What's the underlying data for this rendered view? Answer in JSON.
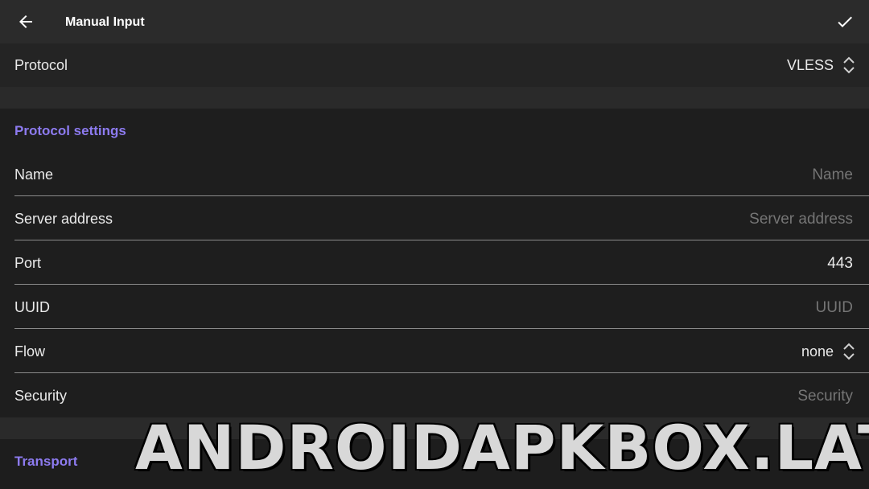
{
  "toolbar": {
    "title": "Manual Input",
    "back_icon": "arrow-left-icon",
    "confirm_icon": "check-icon"
  },
  "protocol": {
    "label": "Protocol",
    "value": "VLESS"
  },
  "protocol_settings": {
    "header": "Protocol settings",
    "fields": [
      {
        "label": "Name",
        "placeholder": "Name",
        "value": ""
      },
      {
        "label": "Server address",
        "placeholder": "Server address",
        "value": ""
      },
      {
        "label": "Port",
        "placeholder": "",
        "value": "443"
      },
      {
        "label": "UUID",
        "placeholder": "UUID",
        "value": ""
      },
      {
        "label": "Flow",
        "value": "none"
      },
      {
        "label": "Security",
        "placeholder": "Security",
        "value": ""
      }
    ]
  },
  "transport": {
    "header": "Transport"
  },
  "watermark": "ANDROIDAPKBOX.LAT",
  "colors": {
    "accent": "#8d7bf0",
    "background": "#1d1d1d",
    "toolbar": "#2b2b2b"
  }
}
